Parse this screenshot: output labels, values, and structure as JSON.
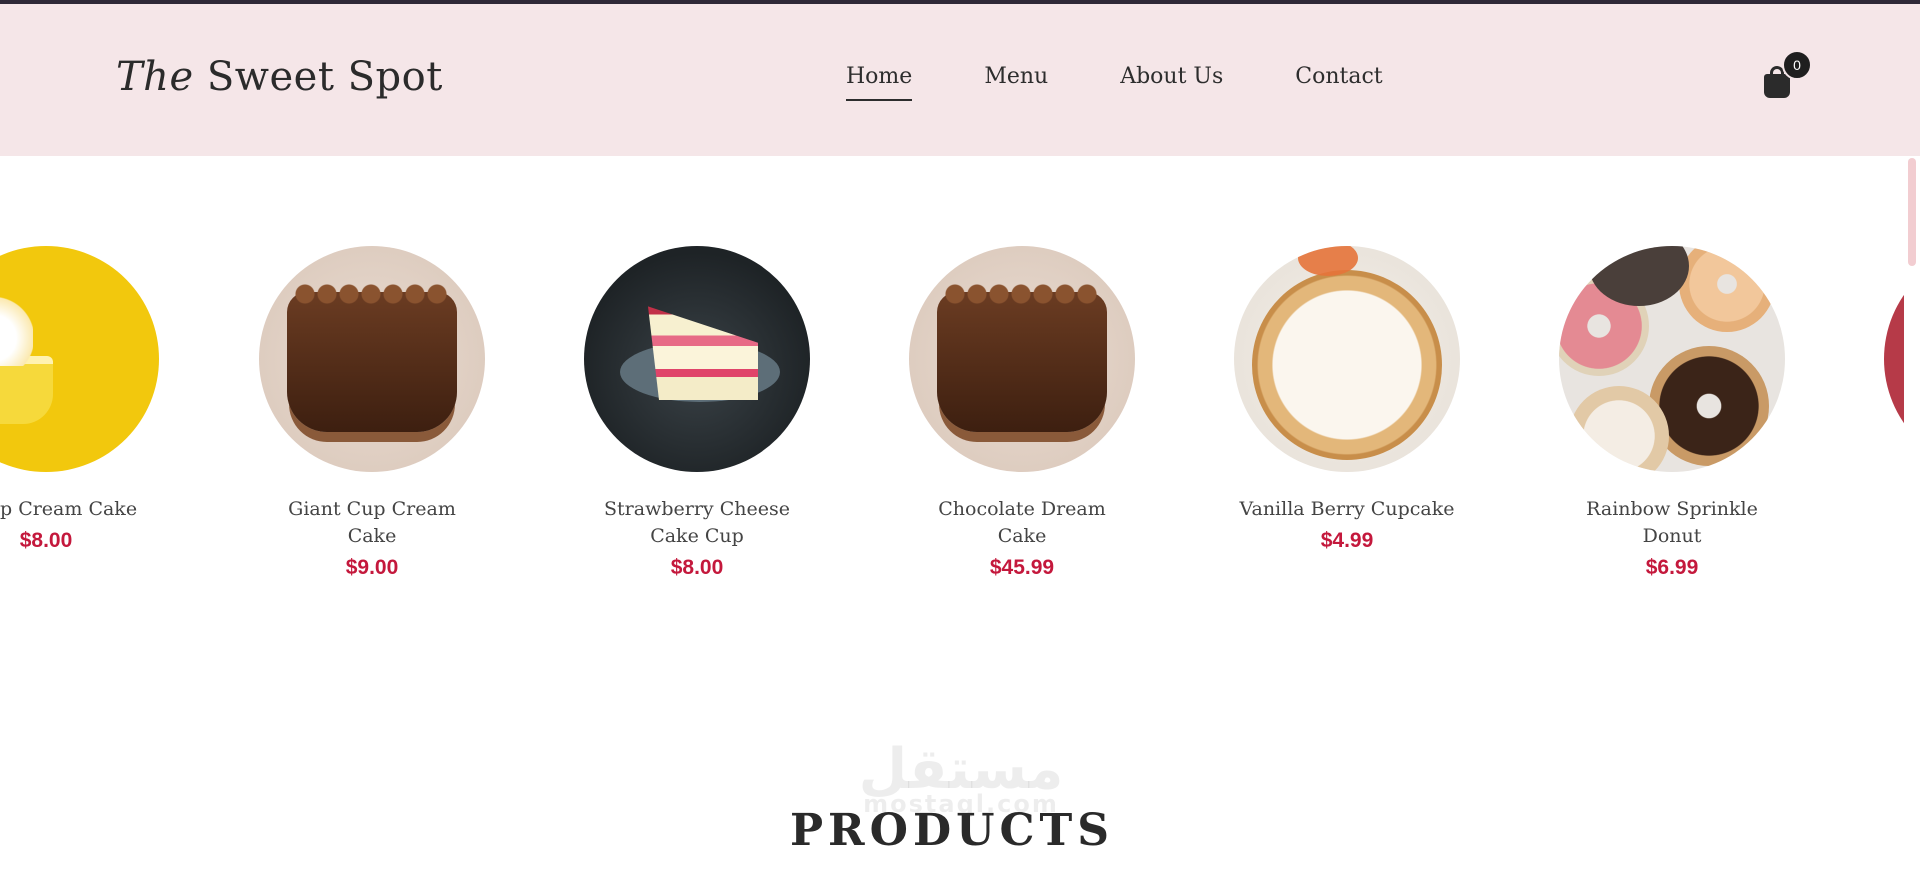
{
  "header": {
    "logo_italic": "The",
    "logo_rest": "Sweet Spot",
    "nav": [
      {
        "label": "Home",
        "active": true
      },
      {
        "label": "Menu",
        "active": false
      },
      {
        "label": "About Us",
        "active": false
      },
      {
        "label": "Contact",
        "active": false
      }
    ],
    "cart_count": "0"
  },
  "carousel": {
    "items": [
      {
        "name": "n Cup Cream Cake",
        "price": "$8.00",
        "icon": "cupcake-image"
      },
      {
        "name": "Giant Cup Cream Cake",
        "price": "$9.00",
        "icon": "chocolate-cake-image"
      },
      {
        "name": "Strawberry Cheese Cake Cup",
        "price": "$8.00",
        "icon": "strawberry-cake-image"
      },
      {
        "name": "Chocolate Dream Cake",
        "price": "$45.99",
        "icon": "chocolate-cake-image"
      },
      {
        "name": "Vanilla Berry Cupcake",
        "price": "$4.99",
        "icon": "meringue-pie-image"
      },
      {
        "name": "Rainbow Sprinkle Donut",
        "price": "$6.99",
        "icon": "donuts-image"
      }
    ]
  },
  "watermark": {
    "arabic": "مستقل",
    "latin": "mostaql.com"
  },
  "section": {
    "title": "PRODUCTS"
  },
  "colors": {
    "header_bg": "#f5e6e8",
    "price": "#c4183c",
    "accent_thumb": "#f2cdd1"
  }
}
